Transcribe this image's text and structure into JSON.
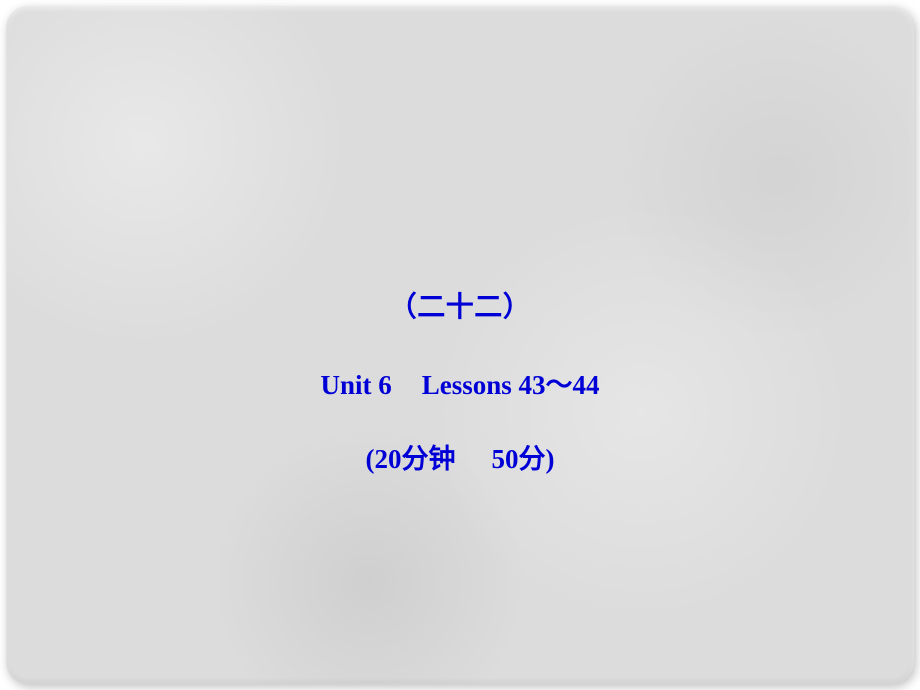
{
  "slide": {
    "title": "（二十二）",
    "unit_label": "Unit 6",
    "lessons_label": "Lessons 43～44",
    "time_label": "(20分钟",
    "score_label": "50分)"
  }
}
